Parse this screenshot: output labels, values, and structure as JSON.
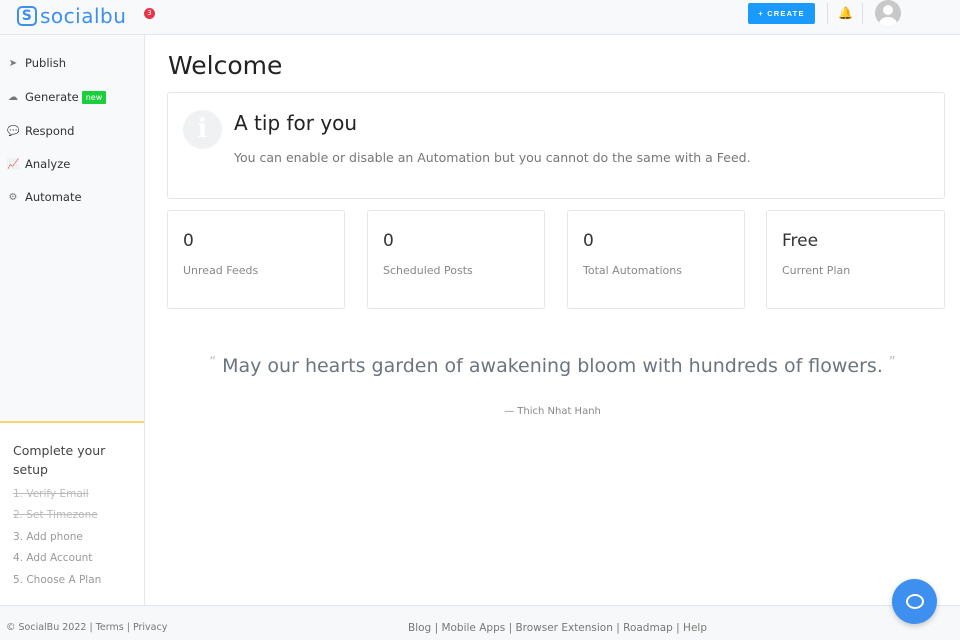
{
  "header": {
    "logo_mark": "S",
    "logo_text": "socialbu",
    "notification_count": "3",
    "create_label": "+ CREATE",
    "bell_icon": "bell-icon",
    "avatar": "user-avatar"
  },
  "sidebar": {
    "items": [
      {
        "label": "Publish",
        "icon": "➤"
      },
      {
        "label": "Generate",
        "icon": "☁",
        "badge": "new"
      },
      {
        "label": "Respond",
        "icon": "💬"
      },
      {
        "label": "Analyze",
        "icon": "📈"
      },
      {
        "label": "Automate",
        "icon": "⚙"
      }
    ],
    "setup": {
      "title": "Complete your setup",
      "steps": [
        "1. Verify Email",
        "2. Set Timezone",
        "3. Add phone",
        "4. Add Account",
        "5. Choose A Plan"
      ]
    }
  },
  "main": {
    "title": "Welcome",
    "tip": {
      "title": "A tip for you",
      "text": "You can enable or disable an Automation but you cannot do the same with a Feed."
    },
    "stats": [
      {
        "value": "0",
        "label": "Unread Feeds"
      },
      {
        "value": "0",
        "label": "Scheduled Posts"
      },
      {
        "value": "0",
        "label": "Total Automations"
      },
      {
        "value": "Free",
        "label": "Current Plan"
      }
    ],
    "quote": {
      "open": "“",
      "text": "May our hearts garden of awakening bloom with hundreds of flowers.",
      "close": "”",
      "author": "— Thich Nhat Hanh"
    }
  },
  "footer": {
    "copyright": "© SocialBu 2022",
    "left_links": [
      "Terms",
      "Privacy"
    ],
    "links": [
      "Blog",
      "Mobile Apps",
      "Browser Extension",
      "Roadmap",
      "Help"
    ],
    "sep": "|"
  }
}
